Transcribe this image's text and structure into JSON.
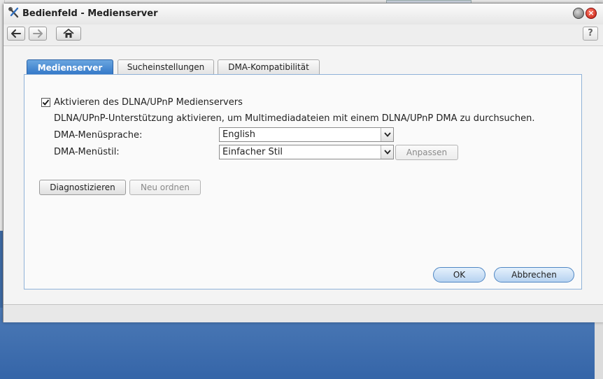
{
  "window": {
    "title": "Bedienfeld - Medienserver",
    "help_label": "?",
    "close_label": "×"
  },
  "toolbar": {
    "back": "arrow-left-icon",
    "forward": "arrow-right-icon",
    "home": "home-icon"
  },
  "tabs": [
    {
      "label": "Medienserver",
      "active": true
    },
    {
      "label": "Sucheinstellungen",
      "active": false
    },
    {
      "label": "DMA-Kompatibilität",
      "active": false
    }
  ],
  "form": {
    "enable_checkbox": {
      "label": "Aktivieren des DLNA/UPnP Medienservers",
      "checked": true
    },
    "description": "DLNA/UPnP-Unterstützung aktivieren, um Multimediadateien mit einem DLNA/UPnP DMA zu durchsuchen.",
    "menu_language": {
      "label": "DMA-Menüsprache:",
      "value": "English"
    },
    "menu_style": {
      "label": "DMA-Menüstil:",
      "value": "Einfacher Stil"
    },
    "customize_label": "Anpassen",
    "diagnose_label": "Diagnostizieren",
    "reorder_label": "Neu ordnen"
  },
  "actions": {
    "ok_label": "OK",
    "cancel_label": "Abbrechen"
  },
  "colors": {
    "active_tab": "#2f74c6",
    "desktop": "#3e6aa3",
    "panel_border": "#8fb2d8"
  }
}
